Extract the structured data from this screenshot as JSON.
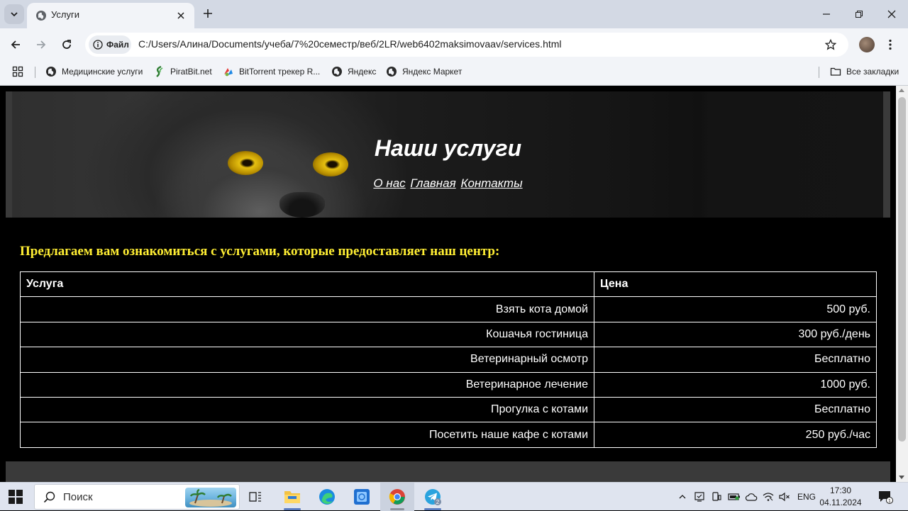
{
  "browser": {
    "tab_title": "Услуги",
    "site_chip_label": "Файл",
    "url": "C:/Users/Алина/Documents/учеба/7%20семестр/веб/2LR/web6402maksimovaav/services.html",
    "bookmarks": [
      {
        "label": "Медицинские услуги",
        "icon": "globe-icon"
      },
      {
        "label": "PiratBit.net",
        "icon": "piratbit-icon"
      },
      {
        "label": "BitTorrent трекер R...",
        "icon": "bittorrent-icon"
      },
      {
        "label": "Яндекс",
        "icon": "globe-icon"
      },
      {
        "label": "Яндекс Маркет",
        "icon": "globe-icon"
      }
    ],
    "all_bookmarks_label": "Все закладки"
  },
  "page": {
    "title": "Наши услуги",
    "nav": [
      {
        "label": "О нас"
      },
      {
        "label": "Главная"
      },
      {
        "label": "Контакты"
      }
    ],
    "intro": "Предлагаем вам ознакомиться с услугами, которые предоставляет наш центр:",
    "table": {
      "headers": [
        "Услуга",
        "Цена"
      ],
      "rows": [
        [
          "Взять кота домой",
          "500 руб."
        ],
        [
          "Кошачья гостиница",
          "300 руб./день"
        ],
        [
          "Ветеринарный осмотр",
          "Бесплатно"
        ],
        [
          "Ветеринарное лечение",
          "1000 руб."
        ],
        [
          "Прогулка с котами",
          "Бесплатно"
        ],
        [
          "Посетить наше кафе с котами",
          "250 руб./час"
        ]
      ]
    },
    "colors": {
      "intro": "#ffee33",
      "background": "#000000",
      "text": "#ffffff",
      "header_footer": "#3a3a3a"
    }
  },
  "taskbar": {
    "search_placeholder": "Поиск",
    "telegram_badge": "2",
    "language": "ENG",
    "time": "17:30",
    "date": "04.11.2024",
    "notification_count": "1"
  }
}
